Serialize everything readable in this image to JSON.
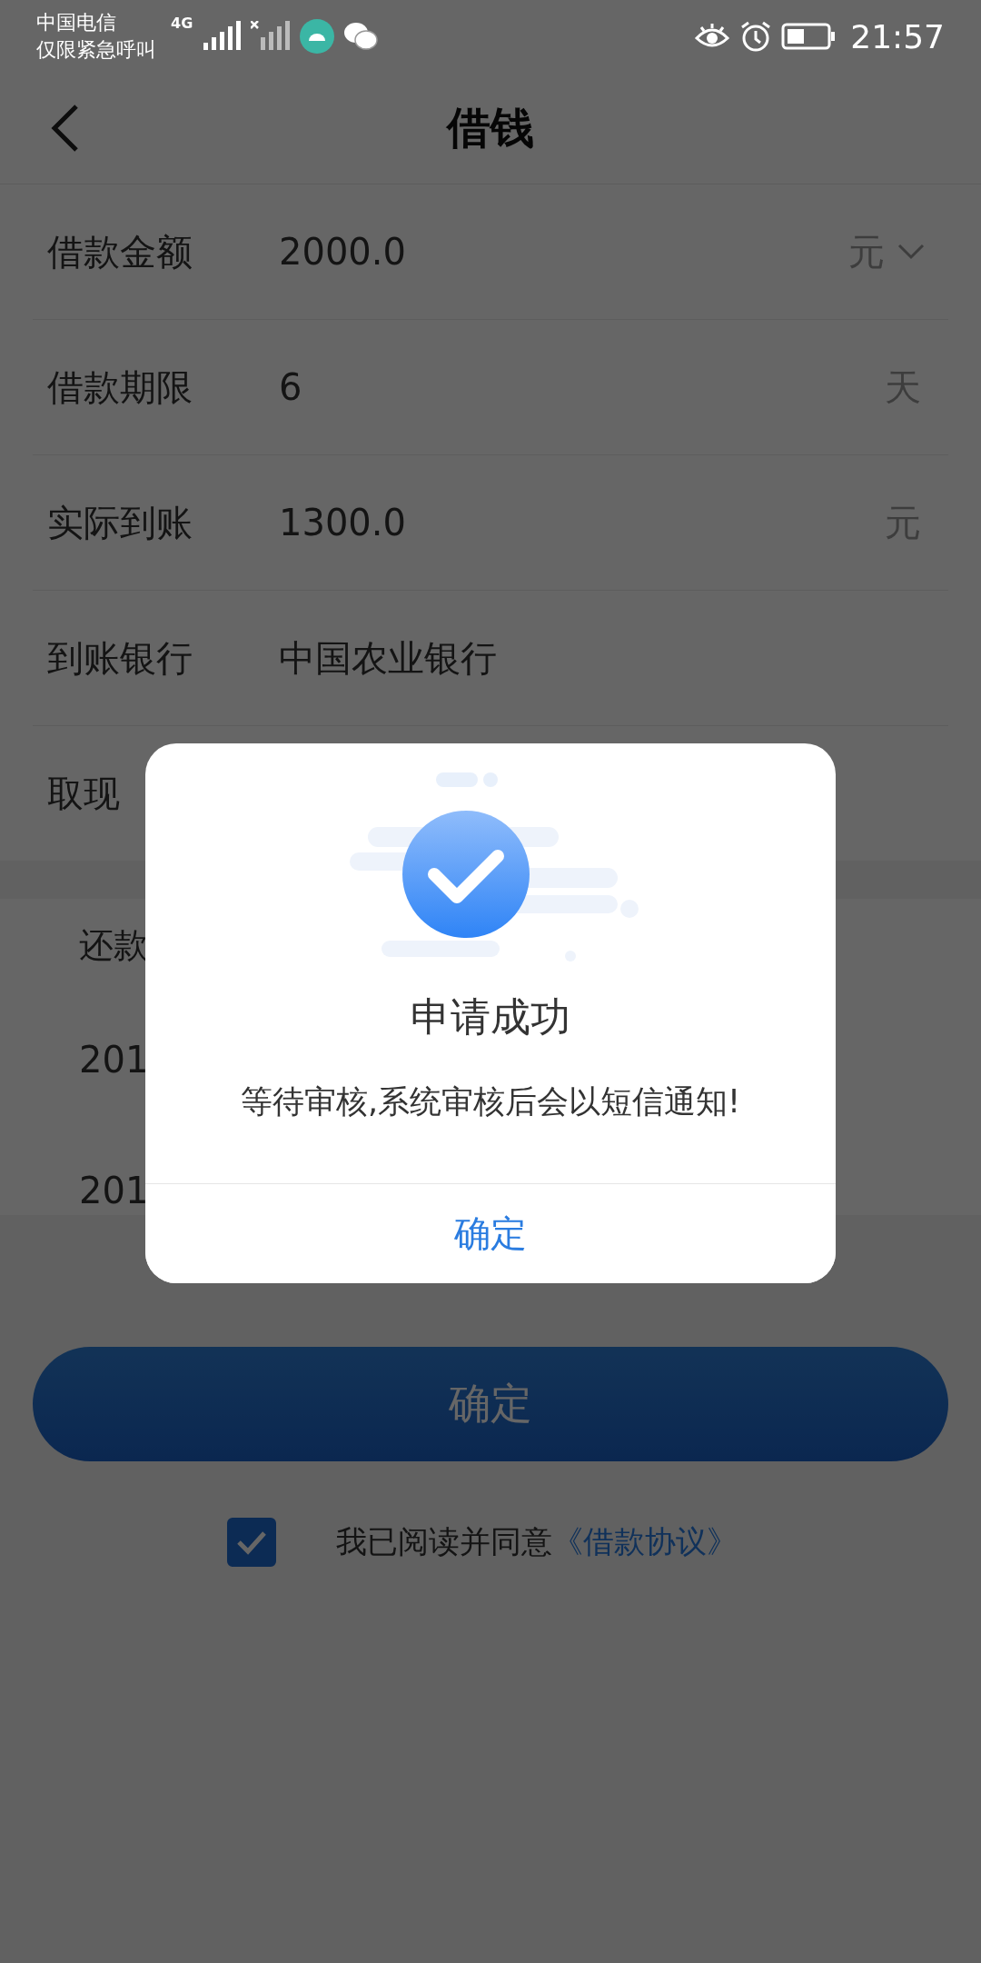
{
  "status_bar": {
    "carrier": "中国电信",
    "carrier_note": "仅限紧急呼叫",
    "network": "4G",
    "time": "21:57"
  },
  "header": {
    "title": "借钱"
  },
  "form_rows": [
    {
      "label": "借款金额",
      "value": "2000.0",
      "unit": "元",
      "dropdown": true
    },
    {
      "label": "借款期限",
      "value": "6",
      "unit": "天",
      "dropdown": false
    },
    {
      "label": "实际到账",
      "value": "1300.0",
      "unit": "元",
      "dropdown": false
    },
    {
      "label": "到账银行",
      "value": "中国农业银行",
      "dropdown": false
    },
    {
      "label": "取现",
      "dropdown": false
    }
  ],
  "repayment": {
    "title": "还款",
    "items": [
      "201",
      "201"
    ]
  },
  "submit_button": {
    "label": "确定"
  },
  "agreement": {
    "checked": true,
    "text": "我已阅读并同意",
    "link": "《借款协议》"
  },
  "dialog": {
    "title": "申请成功",
    "message": "等待审核,系统审核后会以短信通知!",
    "button": "确定"
  }
}
